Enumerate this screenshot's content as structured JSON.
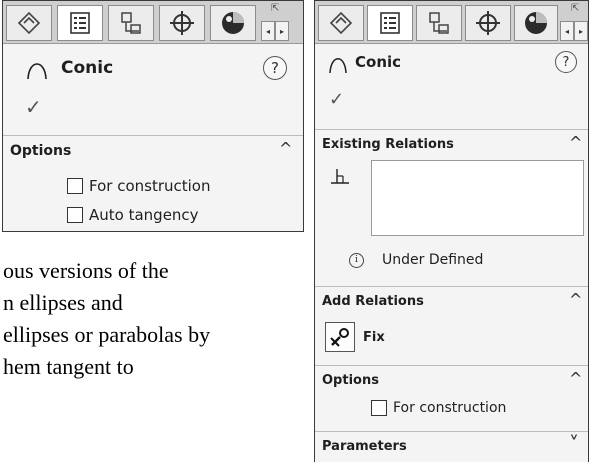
{
  "left_panel": {
    "title": "Conic",
    "help": "?",
    "ok": "✓",
    "options_header": "Options",
    "options_chevron": "^",
    "options": [
      {
        "label": "For construction",
        "checked": false
      },
      {
        "label": "Auto tangency",
        "checked": false
      }
    ]
  },
  "right_panel": {
    "title": "Conic",
    "help": "?",
    "ok": "✓",
    "existing_relations_header": "Existing Relations",
    "existing_relations_chevron": "^",
    "status": "Under Defined",
    "add_relations_header": "Add Relations",
    "add_relations_chevron": "^",
    "fix_label": "Fix",
    "options_header": "Options",
    "options_chevron": "^",
    "options": [
      {
        "label": "For construction",
        "checked": false
      }
    ],
    "parameters_header": "Parameters",
    "parameters_chevron": "˅"
  },
  "tabs": [
    {
      "icon": "feature-manager-icon"
    },
    {
      "icon": "property-manager-icon",
      "active": true
    },
    {
      "icon": "configuration-manager-icon"
    },
    {
      "icon": "dimxpert-manager-icon"
    },
    {
      "icon": "display-manager-icon"
    }
  ],
  "tab_scroll": {
    "left": "◂",
    "right": "▸",
    "collapse": "⇱"
  },
  "document_text": {
    "line1": "ous versions of the",
    "line2": "n ellipses and",
    "line3": "ellipses or parabolas by",
    "line4": "hem tangent to",
    "line5": "         "
  },
  "colors": {
    "panel_bg": "#f4f4f4",
    "tabbar_bg": "#cfcfcf",
    "border": "#3a3a3a"
  }
}
